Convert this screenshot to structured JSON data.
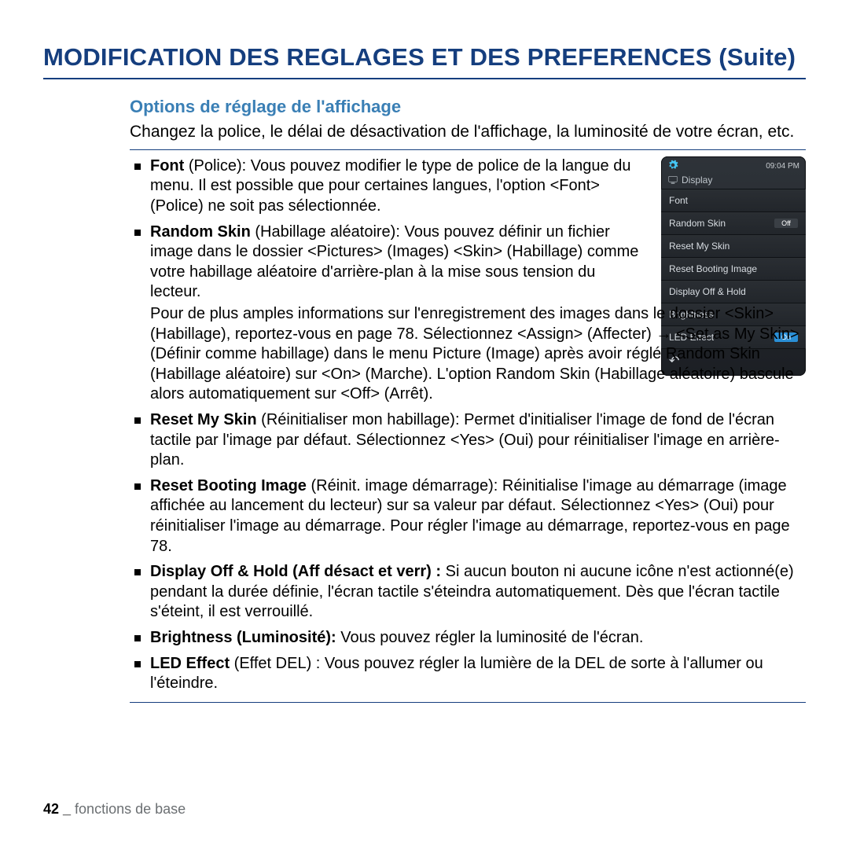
{
  "title": "MODIFICATION DES REGLAGES ET DES PREFERENCES (Suite)",
  "heading": "Options de réglage de l'affichage",
  "intro": "Changez la police, le délai de désactivation de l'affichage, la luminosité de votre écran, etc.",
  "bullets": [
    {
      "label": "Font",
      "paren": " (Police): ",
      "text": "Vous pouvez modifier le type de police de la langue du menu. Il est possible que pour certaines langues, l'option <Font> (Police) ne soit pas sélectionnée.",
      "narrow": true
    },
    {
      "label": "Random Skin",
      "paren": " (Habillage aléatoire): ",
      "text": "Vous pouvez définir un fichier image dans le dossier <Pictures> (Images) <Skin> (Habillage) comme votre habillage aléatoire d'arrière-plan à la mise sous tension du lecteur.",
      "narrow": true,
      "extra": "Pour de plus amples informations sur l'enregistrement des images dans le dossier <Skin> (Habillage), reportez-vous en page 78. Sélectionnez <Assign> (Affecter) → <Set as My Skin> (Définir comme habillage) dans le menu Picture (Image) après avoir réglé Random Skin (Habillage aléatoire) sur <On> (Marche). L'option Random Skin (Habillage aléatoire) bascule alors automatiquement sur <Off> (Arrêt)."
    },
    {
      "label": "Reset My Skin",
      "paren": " (Réinitialiser mon habillage): ",
      "text": "Permet d'initialiser l'image de fond de l'écran tactile par l'image par défaut. Sélectionnez <Yes> (Oui) pour réinitialiser l'image en arrière-plan."
    },
    {
      "label": "Reset Booting Image",
      "paren": " (Réinit. image démarrage): ",
      "text": "Réinitialise l'image au démarrage (image affichée au lancement du lecteur) sur sa valeur par défaut. Sélectionnez <Yes> (Oui) pour réinitialiser l'image au démarrage. Pour régler l'image au démarrage, reportez-vous en page 78."
    },
    {
      "label": "Display Off & Hold (Aff désact et verr) :",
      "paren": " ",
      "text": "Si aucun bouton ni aucune icône n'est actionné(e) pendant la durée définie, l'écran tactile s'éteindra automatiquement. Dès que l'écran tactile s'éteint, il est verrouillé."
    },
    {
      "label": "Brightness (Luminosité):",
      "paren": " ",
      "text": "Vous pouvez régler la luminosité de l'écran."
    },
    {
      "label": "LED Effect",
      "paren": " (Effet DEL) : ",
      "text": "Vous pouvez régler la lumière de la DEL de sorte à l'allumer ou l'éteindre."
    }
  ],
  "device": {
    "time": "09:04 PM",
    "header": "Display",
    "items": [
      {
        "label": "Font"
      },
      {
        "label": "Random Skin",
        "toggle": "Off",
        "toggleClass": "off"
      },
      {
        "label": "Reset My Skin"
      },
      {
        "label": "Reset Booting Image"
      },
      {
        "label": "Display Off & Hold"
      },
      {
        "label": "Brightness"
      },
      {
        "label": "LED Effect",
        "toggle": "On",
        "toggleClass": "on"
      }
    ]
  },
  "footer": {
    "page": "42",
    "sep": " _ ",
    "label": "fonctions de base"
  }
}
